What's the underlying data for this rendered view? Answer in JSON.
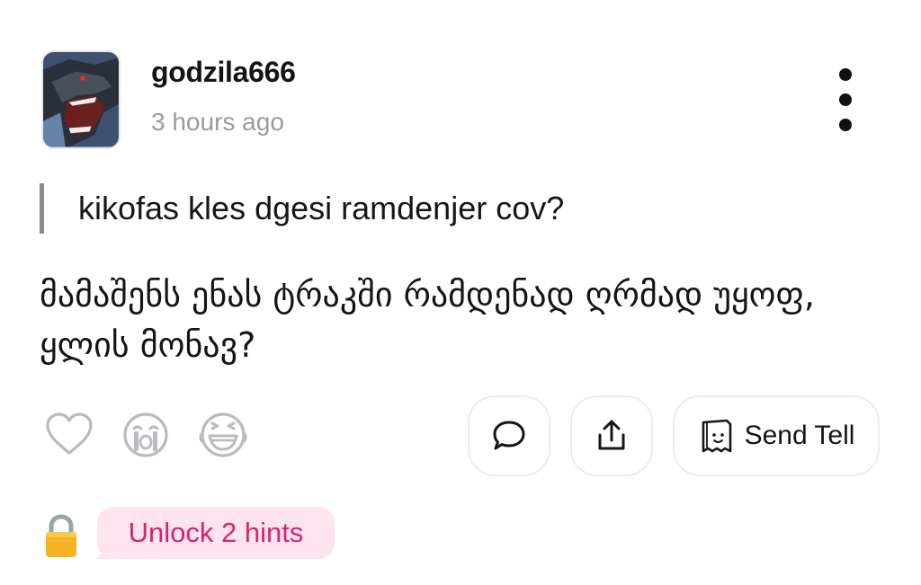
{
  "post": {
    "username": "godzila666",
    "timestamp": "3 hours ago",
    "question": "kikofas kles dgesi ramdenjer cov?",
    "answer": "მამაშენს ენას ტრაკში რამდენად ღრმად უყოფ, ყლის მონავ?"
  },
  "icons": {
    "avatar": "godzilla-avatar",
    "more": "more-vertical-icon",
    "reactions": [
      "heart-icon",
      "crying-face-icon",
      "laughing-face-icon"
    ],
    "comment": "speech-bubble-icon",
    "share": "share-icon",
    "tell": "paper-bag-face-icon",
    "lock": "lock-icon"
  },
  "actions": {
    "send_tell_label": "Send Tell",
    "unlock_hints_label": "Unlock 2 hints"
  },
  "colors": {
    "hint_bg": "#fde4ef",
    "hint_text": "#d6236f",
    "muted_text": "#9a9aa0"
  }
}
